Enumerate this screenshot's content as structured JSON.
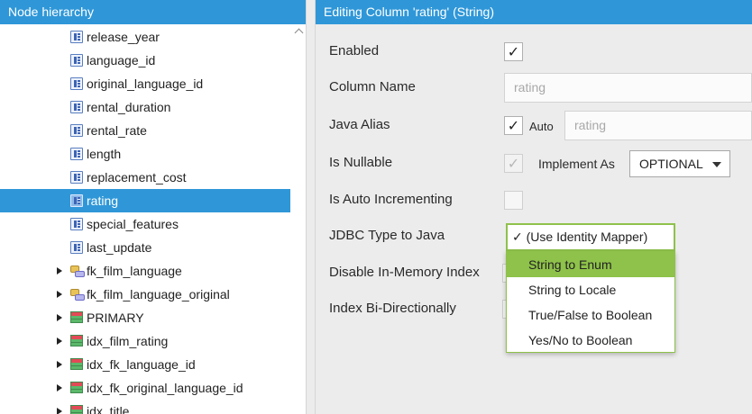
{
  "left_panel": {
    "header": "Node hierarchy",
    "tree": [
      {
        "label": "release_year",
        "icon": "column-icon",
        "indent": 2
      },
      {
        "label": "language_id",
        "icon": "column-icon",
        "indent": 2
      },
      {
        "label": "original_language_id",
        "icon": "column-icon",
        "indent": 2
      },
      {
        "label": "rental_duration",
        "icon": "column-icon",
        "indent": 2
      },
      {
        "label": "rental_rate",
        "icon": "column-icon",
        "indent": 2
      },
      {
        "label": "length",
        "icon": "column-icon",
        "indent": 2
      },
      {
        "label": "replacement_cost",
        "icon": "column-icon",
        "indent": 2
      },
      {
        "label": "rating",
        "icon": "column-icon",
        "indent": 2,
        "selected": true
      },
      {
        "label": "special_features",
        "icon": "column-icon",
        "indent": 2
      },
      {
        "label": "last_update",
        "icon": "column-icon",
        "indent": 2
      },
      {
        "label": "fk_film_language",
        "icon": "foreign-key-icon",
        "indent": 1,
        "expandable": true
      },
      {
        "label": "fk_film_language_original",
        "icon": "foreign-key-icon",
        "indent": 1,
        "expandable": true
      },
      {
        "label": "PRIMARY",
        "icon": "index-icon",
        "indent": 1,
        "expandable": true
      },
      {
        "label": "idx_film_rating",
        "icon": "index-icon",
        "indent": 1,
        "expandable": true
      },
      {
        "label": "idx_fk_language_id",
        "icon": "index-icon",
        "indent": 1,
        "expandable": true
      },
      {
        "label": "idx_fk_original_language_id",
        "icon": "index-icon",
        "indent": 1,
        "expandable": true
      },
      {
        "label": "idx_title",
        "icon": "index-icon",
        "indent": 1,
        "expandable": true
      }
    ]
  },
  "right_panel": {
    "header": "Editing Column 'rating' (String)",
    "enabled": {
      "label": "Enabled",
      "checked": true
    },
    "column_name": {
      "label": "Column Name",
      "value": "rating"
    },
    "java_alias": {
      "label": "Java Alias",
      "auto_label": "Auto",
      "auto_checked": true,
      "value": "rating"
    },
    "is_nullable": {
      "label": "Is Nullable",
      "checked": true,
      "implement_as_label": "Implement As",
      "implement_as_value": "OPTIONAL"
    },
    "is_auto_incrementing": {
      "label": "Is Auto Incrementing",
      "checked": false
    },
    "jdbc_type": {
      "label": "JDBC Type to Java",
      "selected": "✓ (Use Identity Mapper)",
      "options": [
        "String to Enum",
        "String to Locale",
        "True/False to Boolean",
        "Yes/No to Boolean"
      ],
      "hovered_option": "String to Enum"
    },
    "disable_in_memory_index": {
      "label": "Disable In-Memory Index"
    },
    "index_bi_directionally": {
      "label": "Index Bi-Directionally"
    }
  },
  "colors": {
    "accent": "#2f97d8",
    "dropdown_highlight": "#8ec24a"
  }
}
